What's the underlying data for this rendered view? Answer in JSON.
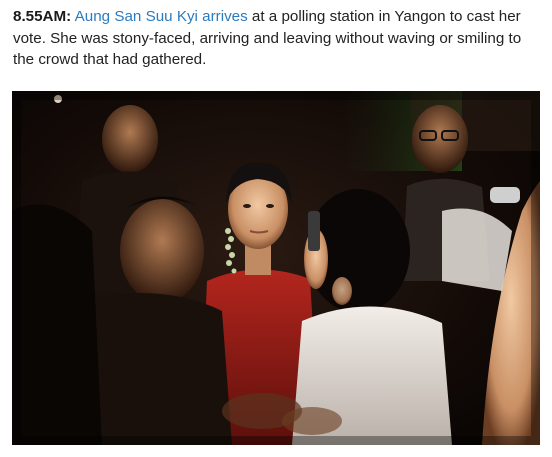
{
  "article": {
    "timestamp": "8.55AM:",
    "subject_link": "Aung San Suu Kyi arrives",
    "caption_rest": " at a polling station in Yangon to cast her vote. She was stony-faced, arriving and leaving without waving or smiling to the crowd that had gathered.",
    "link_color": "#2a7bbf"
  },
  "photo": {
    "description_icon": "news-photo"
  }
}
